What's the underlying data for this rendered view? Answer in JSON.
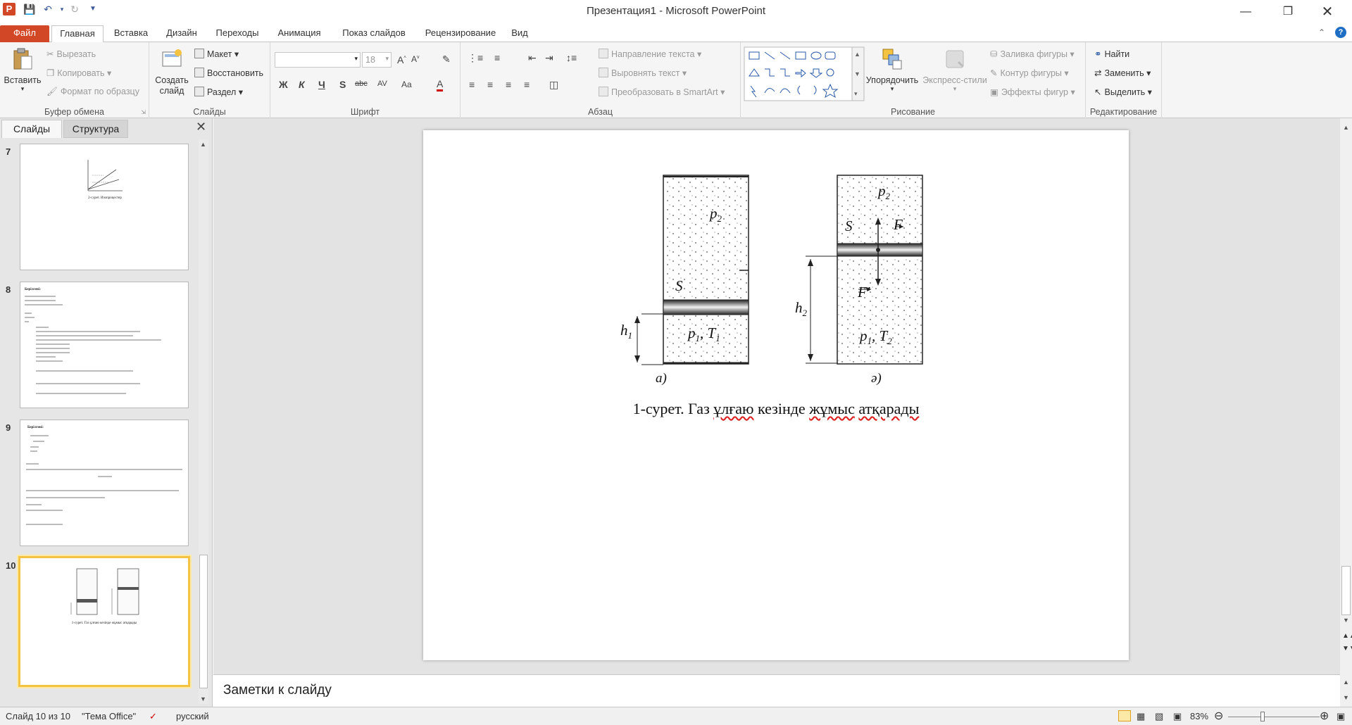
{
  "window": {
    "title": "Презентация1 - Microsoft PowerPoint",
    "app_logo": "P"
  },
  "tabs": [
    {
      "label": "Файл"
    },
    {
      "label": "Главная"
    },
    {
      "label": "Вставка"
    },
    {
      "label": "Дизайн"
    },
    {
      "label": "Переходы"
    },
    {
      "label": "Анимация"
    },
    {
      "label": "Показ слайдов"
    },
    {
      "label": "Рецензирование"
    },
    {
      "label": "Вид"
    }
  ],
  "ribbon": {
    "clipboard": {
      "paste": "Вставить",
      "cut": "Вырезать",
      "copy": "Копировать",
      "format_painter": "Формат по образцу",
      "label": "Буфер обмена"
    },
    "slides": {
      "new_slide": "Создать слайд",
      "layout": "Макет",
      "reset": "Восстановить",
      "section": "Раздел",
      "label": "Слайды"
    },
    "font": {
      "size": "18",
      "label": "Шрифт",
      "bold": "Ж",
      "italic": "К",
      "underline": "Ч",
      "strike": "S",
      "abc": "abc",
      "spacing": "AV",
      "case": "Aa",
      "color": "A"
    },
    "paragraph": {
      "text_direction": "Направление текста",
      "align_text": "Выровнять текст",
      "smartart": "Преобразовать в SmartArt",
      "label": "Абзац"
    },
    "drawing": {
      "arrange": "Упорядочить",
      "quick_styles": "Экспресс-стили",
      "shape_fill": "Заливка фигуры",
      "shape_outline": "Контур фигуры",
      "shape_effects": "Эффекты фигур",
      "label": "Рисование"
    },
    "editing": {
      "find": "Найти",
      "replace": "Заменить",
      "select": "Выделить",
      "label": "Редактирование"
    }
  },
  "panel": {
    "tab_slides": "Слайды",
    "tab_outline": "Структура",
    "thumbnails": [
      {
        "num": "7",
        "caption": "2-сурет. Изопроцестер"
      },
      {
        "num": "8",
        "caption": "Берілгені:"
      },
      {
        "num": "9",
        "caption": "Берілгені:"
      },
      {
        "num": "10",
        "caption": "1-сурет. Газ ұлғаю кезінде жұмыс атқарады"
      }
    ]
  },
  "slide": {
    "caption_prefix": "1-сурет. Газ ",
    "caption_w1": "ұлғаю",
    "caption_w2": "кезінде",
    "caption_w3": "жұмыс",
    "caption_w4": "атқарады",
    "fig_a_label": "а)",
    "fig_b_label": "ә)",
    "p2": "p",
    "p2_sub": "2",
    "s": "S",
    "p1": "p",
    "p1_sub": "1",
    "t1": "T",
    "t1_sub": "1",
    "h1": "h",
    "h1_sub": "1",
    "h2": "h",
    "h2_sub": "2",
    "t2_sub": "2",
    "f": "F",
    "f_prime": "F'"
  },
  "notes": {
    "placeholder": "Заметки к слайду"
  },
  "status": {
    "slide_info": "Слайд 10 из 10",
    "theme": "\"Тема Office\"",
    "language": "русский",
    "zoom": "83%"
  },
  "colors": {
    "accent": "#d24726",
    "selection": "#f5c342"
  }
}
